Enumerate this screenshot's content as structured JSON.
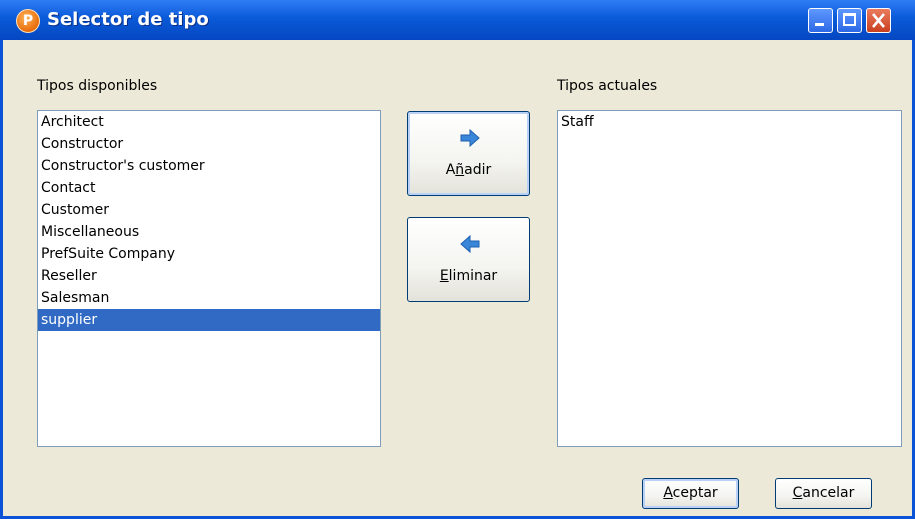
{
  "window": {
    "title": "Selector de tipo",
    "app_icon_letter": "P",
    "title_bar_color": "#0a5ad8"
  },
  "available": {
    "label": "Tipos disponibles",
    "items": [
      "Architect",
      "Constructor",
      "Constructor's customer",
      "Contact",
      "Customer",
      "Miscellaneous",
      "PrefSuite Company",
      "Reseller",
      "Salesman",
      "supplier"
    ],
    "selected": "supplier"
  },
  "current": {
    "label": "Tipos actuales",
    "items": [
      "Staff"
    ]
  },
  "actions": {
    "add": {
      "label": "Añadir",
      "icon": "arrow-right-icon"
    },
    "remove": {
      "label": "Eliminar",
      "icon": "arrow-left-icon"
    }
  },
  "footer": {
    "accept_label": "Aceptar",
    "cancel_label": "Cancelar"
  },
  "colors": {
    "selection": "#316ac5",
    "dialog_bg": "#ece9d8",
    "arrow": "#3a86d8"
  }
}
